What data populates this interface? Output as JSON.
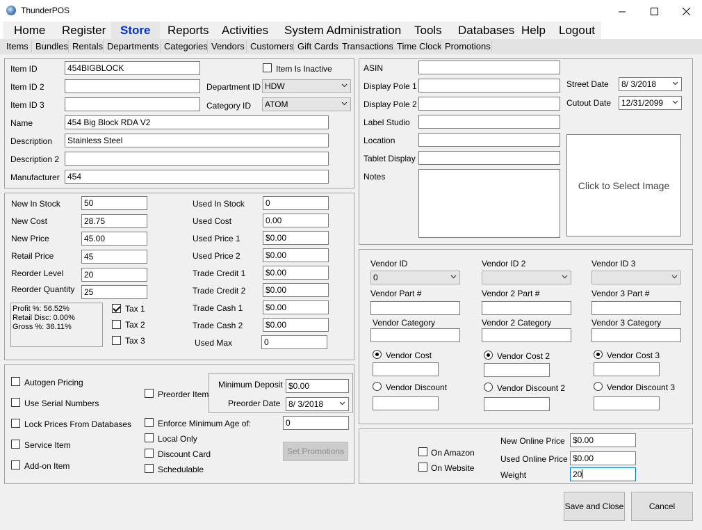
{
  "window": {
    "title": "ThunderPOS"
  },
  "menu": {
    "items": [
      "Home",
      "Register",
      "Store",
      "Reports",
      "Activities",
      "System Administration",
      "Tools",
      "Databases",
      "Help",
      "Logout"
    ]
  },
  "submenu": {
    "items": [
      "Items",
      "Bundles",
      "Rentals",
      "Departments",
      "Categories",
      "Vendors",
      "Customers",
      "Gift Cards",
      "Transactions",
      "Time Clock",
      "Promotions"
    ]
  },
  "item": {
    "item_id_label": "Item ID",
    "item_id": "454BIGBLOCK",
    "inactive_label": "Item Is Inactive",
    "item_id2_label": "Item ID 2",
    "item_id2": "",
    "department_label": "Department ID",
    "department": "HDW",
    "item_id3_label": "Item ID 3",
    "item_id3": "",
    "category_label": "Category ID",
    "category": "ATOM",
    "name_label": "Name",
    "name": "454 Big Block RDA V2",
    "description_label": "Description",
    "description": "Stainless Steel",
    "description2_label": "Description 2",
    "description2": "",
    "manufacturer_label": "Manufacturer",
    "manufacturer": "454"
  },
  "pricing": {
    "new_in_stock_label": "New In Stock",
    "new_in_stock": "50",
    "new_cost_label": "New Cost",
    "new_cost": "28.75",
    "new_price_label": "New Price",
    "new_price": "45.00",
    "retail_price_label": "Retail Price",
    "retail_price": "45",
    "reorder_level_label": "Reorder Level",
    "reorder_level": "20",
    "reorder_quantity_label": "Reorder Quantity",
    "reorder_quantity": "25",
    "profit_line": "Profit %: 56.52%",
    "retail_disc_line": "Retail Disc: 0.00%",
    "gross_line": "Gross %: 36.11%",
    "tax1_label": "Tax 1",
    "tax2_label": "Tax 2",
    "tax3_label": "Tax 3",
    "used_in_stock_label": "Used In Stock",
    "used_in_stock": "0",
    "used_cost_label": "Used Cost",
    "used_cost": "0.00",
    "used_price1_label": "Used Price 1",
    "used_price1": "$0.00",
    "used_price2_label": "Used Price 2",
    "used_price2": "$0.00",
    "trade_credit1_label": "Trade Credit 1",
    "trade_credit1": "$0.00",
    "trade_credit2_label": "Trade Credit 2",
    "trade_credit2": "$0.00",
    "trade_cash1_label": "Trade Cash 1",
    "trade_cash1": "$0.00",
    "trade_cash2_label": "Trade Cash 2",
    "trade_cash2": "$0.00",
    "used_max_label": "Used Max",
    "used_max": "0"
  },
  "options": {
    "autogen_label": "Autogen Pricing",
    "serial_label": "Use Serial Numbers",
    "lock_label": "Lock Prices From Databases",
    "service_label": "Service Item",
    "addon_label": "Add-on Item",
    "preorder_label": "Preorder Item",
    "min_deposit_label": "Minimum Deposit",
    "min_deposit": "$0.00",
    "preorder_date_label": "Preorder Date",
    "preorder_date": "8/ 3/2018",
    "min_age_label": "Enforce Minimum Age of:",
    "min_age": "0",
    "local_only_label": "Local Only",
    "discount_card_label": "Discount Card",
    "schedulable_label": "Schedulable",
    "set_promotions_label": "Set Promotions"
  },
  "details": {
    "asin_label": "ASIN",
    "asin": "",
    "pole1_label": "Display Pole 1",
    "pole1": "",
    "pole2_label": "Display Pole 2",
    "pole2": "",
    "label_studio_label": "Label Studio",
    "label_studio": "",
    "location_label": "Location",
    "location": "",
    "tablet_label": "Tablet Display",
    "tablet": "",
    "notes_label": "Notes",
    "street_date_label": "Street Date",
    "street_date": "8/ 3/2018",
    "cutout_date_label": "Cutout Date",
    "cutout_date": "12/31/2099",
    "image_placeholder": "Click to Select Image"
  },
  "vendors": {
    "v1_id_label": "Vendor ID",
    "v1_id": "0",
    "v2_id_label": "Vendor ID 2",
    "v2_id": "",
    "v3_id_label": "Vendor ID 3",
    "v3_id": "",
    "v1_part_label": "Vendor Part #",
    "v2_part_label": "Vendor 2 Part #",
    "v3_part_label": "Vendor 3 Part #",
    "v1_cat_label": "Vendor Category",
    "v2_cat_label": "Vendor 2 Category",
    "v3_cat_label": "Vendor 3 Category",
    "v1_cost_label": "Vendor Cost",
    "v2_cost_label": "Vendor Cost 2",
    "v3_cost_label": "Vendor Cost 3",
    "v1_disc_label": "Vendor Discount",
    "v2_disc_label": "Vendor Discount 2",
    "v3_disc_label": "Vendor Discount 3"
  },
  "online": {
    "amazon_label": "On Amazon",
    "website_label": "On Website",
    "new_online_label": "New Online Price",
    "new_online": "$0.00",
    "used_online_label": "Used Online Price",
    "used_online": "$0.00",
    "weight_label": "Weight",
    "weight": "20"
  },
  "actions": {
    "save_label": "Save and Close",
    "cancel_label": "Cancel"
  },
  "icons": {
    "app": "thunderpos-logo-icon",
    "minimize": "minimize-icon",
    "maximize": "maximize-icon",
    "close": "close-icon",
    "dropdown": "chevron-down-icon"
  },
  "colors": {
    "active_menu": "#0033cc",
    "focus_border": "#0078d7"
  }
}
